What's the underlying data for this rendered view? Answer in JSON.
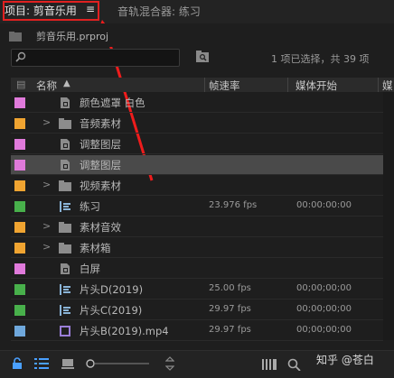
{
  "tabs": {
    "project_label": "项目: 剪音乐用",
    "project_menu": "≡",
    "mixer_label": "音轨混合器: 练习"
  },
  "file": {
    "name": "剪音乐用.prproj"
  },
  "search": {
    "placeholder": "",
    "status": "1 项已选择，共 39 项"
  },
  "columns": {
    "name": "名称",
    "fps": "帧速率",
    "start": "媒体开始",
    "extra": "媒"
  },
  "colors": {
    "violet": "#e07adb",
    "orange": "#f0a431",
    "green": "#48b04b",
    "blue": "#6fa8dc",
    "highlight": "#e02020"
  },
  "rows": [
    {
      "name": "颜色遮罩 白色",
      "type": "matte",
      "color": "violet",
      "fps": "",
      "start": ""
    },
    {
      "name": "音频素材",
      "type": "bin",
      "color": "orange",
      "fps": "",
      "start": ""
    },
    {
      "name": "调整图层",
      "type": "adjust",
      "color": "violet",
      "fps": "",
      "start": ""
    },
    {
      "name": "调整图层",
      "type": "adjust",
      "color": "violet",
      "fps": "",
      "start": "",
      "selected": true
    },
    {
      "name": "视频素材",
      "type": "bin",
      "color": "orange",
      "fps": "",
      "start": ""
    },
    {
      "name": "练习",
      "type": "sequence",
      "color": "green",
      "fps": "23.976 fps",
      "start": "00:00:00:00"
    },
    {
      "name": "素材音效",
      "type": "bin",
      "color": "orange",
      "fps": "",
      "start": ""
    },
    {
      "name": "素材箱",
      "type": "bin",
      "color": "orange",
      "fps": "",
      "start": ""
    },
    {
      "name": "白屏",
      "type": "matte",
      "color": "violet",
      "fps": "",
      "start": ""
    },
    {
      "name": "片头D(2019)",
      "type": "sequence",
      "color": "green",
      "fps": "25.00 fps",
      "start": "00;00;00;00"
    },
    {
      "name": "片头C(2019)",
      "type": "sequence",
      "color": "green",
      "fps": "29.97 fps",
      "start": "00;00;00;00"
    },
    {
      "name": "片头B(2019).mp4",
      "type": "clip",
      "color": "blue",
      "fps": "29.97 fps",
      "start": "00;00;00;00"
    }
  ],
  "watermark": "知乎 @苍白"
}
